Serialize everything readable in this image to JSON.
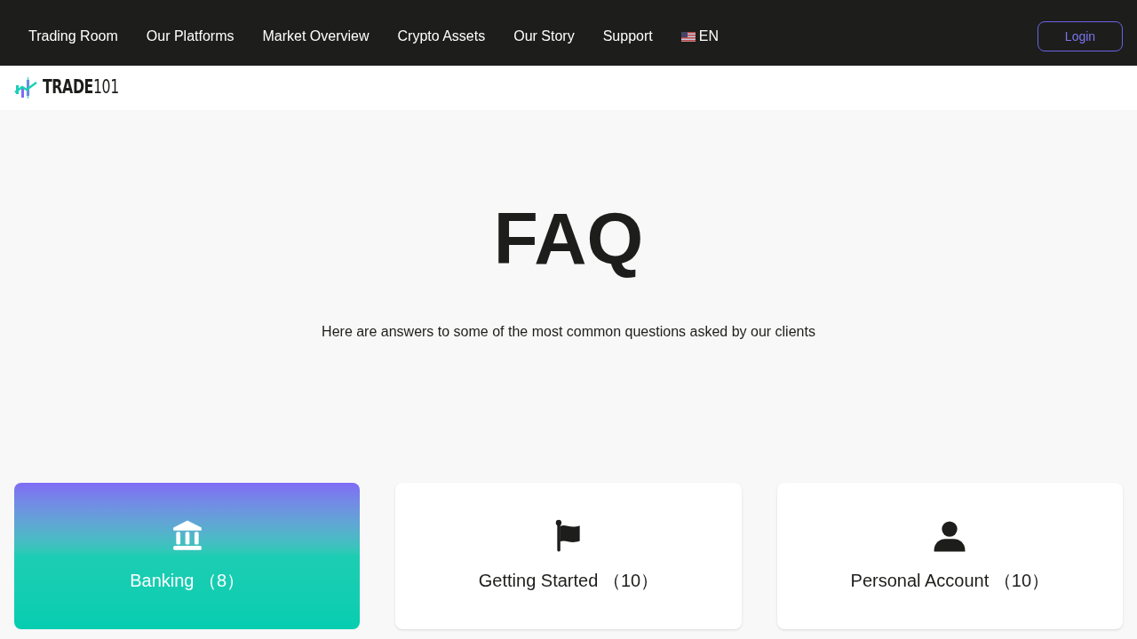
{
  "nav": {
    "items": [
      {
        "label": "Trading Room"
      },
      {
        "label": "Our Platforms"
      },
      {
        "label": "Market Overview"
      },
      {
        "label": "Crypto Assets"
      },
      {
        "label": "Our Story"
      },
      {
        "label": "Support"
      }
    ],
    "language": "EN",
    "login": "Login"
  },
  "logo": {
    "text": "**TRADE**101"
  },
  "hero": {
    "title": "FAQ",
    "subtitle": "Here are answers to some of the most common questions asked by our clients"
  },
  "categories": [
    {
      "kind": "bank",
      "label": "Banking",
      "count": "（8）",
      "selected": true
    },
    {
      "kind": "flag",
      "label": "Getting Started",
      "count": "（10）",
      "selected": false
    },
    {
      "kind": "person",
      "label": "Personal Account",
      "count": "（10）",
      "selected": false
    }
  ]
}
